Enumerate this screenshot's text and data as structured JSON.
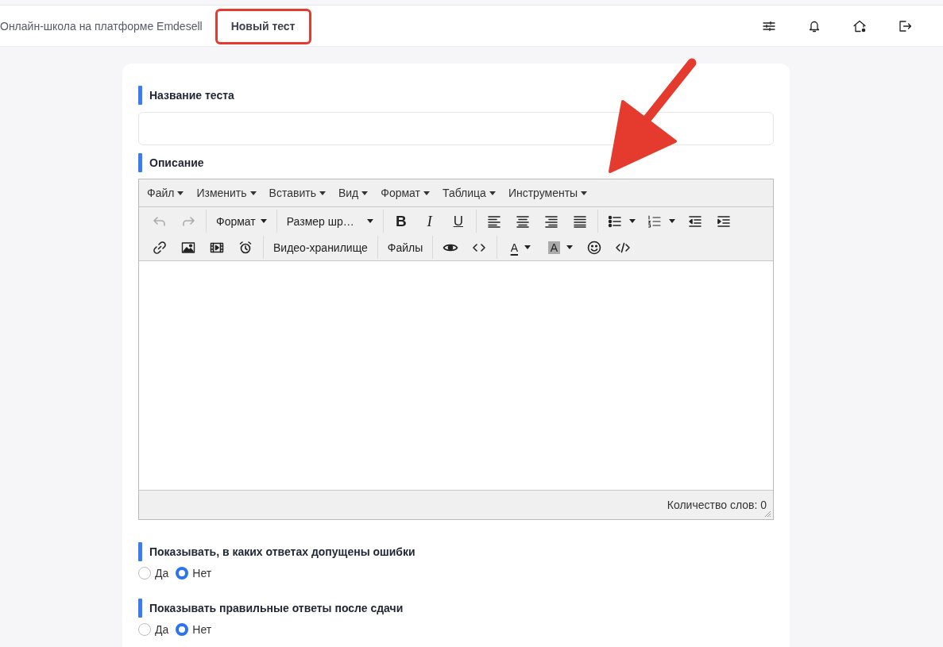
{
  "header": {
    "school": "Онлайн-школа на платформе Emdesell",
    "page_title": "Новый тест"
  },
  "sections": [
    {
      "kind": "text-input",
      "label": "Название теста"
    },
    {
      "kind": "editor",
      "label": "Описание",
      "editor": {
        "menu": [
          {
            "label": "Файл"
          },
          {
            "label": "Изменить"
          },
          {
            "label": "Вставить"
          },
          {
            "label": "Вид"
          },
          {
            "label": "Формат"
          },
          {
            "label": "Таблица"
          },
          {
            "label": "Инструменты"
          }
        ],
        "toolbar": [
          [
            [
              {
                "kind": "undo",
                "disabled": true
              },
              {
                "kind": "redo",
                "disabled": true
              }
            ],
            [
              {
                "kind": "dropdown",
                "label": "Формат",
                "disabled": false
              }
            ],
            [
              {
                "kind": "dropdown",
                "label": "Размер шр…",
                "disabled": false
              }
            ],
            [
              {
                "kind": "bold",
                "label": "B",
                "disabled": false
              },
              {
                "kind": "italic",
                "label": "I",
                "disabled": false
              },
              {
                "kind": "underline",
                "label": "U",
                "disabled": false
              }
            ],
            [
              {
                "kind": "alignleft",
                "disabled": false
              },
              {
                "kind": "aligncenter",
                "disabled": false
              },
              {
                "kind": "alignright",
                "disabled": false
              },
              {
                "kind": "justify",
                "disabled": false
              }
            ],
            [
              {
                "kind": "bullist",
                "disabled": false
              },
              {
                "kind": "numlist",
                "disabled": false
              },
              {
                "kind": "outdent",
                "disabled": false
              },
              {
                "kind": "indent",
                "disabled": false
              }
            ]
          ],
          [
            [
              {
                "kind": "link",
                "disabled": false
              },
              {
                "kind": "image",
                "disabled": false
              },
              {
                "kind": "media",
                "disabled": false
              },
              {
                "kind": "alarm",
                "disabled": false
              }
            ],
            [
              {
                "kind": "text",
                "label": "Видео-хранилище",
                "disabled": false
              }
            ],
            [
              {
                "kind": "text",
                "label": "Файлы",
                "disabled": false
              }
            ],
            [
              {
                "kind": "preview",
                "disabled": false
              },
              {
                "kind": "code",
                "disabled": false
              }
            ],
            [
              {
                "kind": "forecolor",
                "label": "A",
                "disabled": false
              },
              {
                "kind": "backcolor",
                "label": "A",
                "disabled": false
              },
              {
                "kind": "emoticon",
                "disabled": false
              },
              {
                "kind": "source",
                "disabled": false
              }
            ]
          ]
        ],
        "status": "Количество слов: 0"
      }
    },
    {
      "kind": "radio",
      "label": "Показывать, в каких ответах допущены ошибки",
      "options": [
        {
          "label": "Да",
          "selected": false
        },
        {
          "label": "Нет",
          "selected": true
        }
      ]
    },
    {
      "kind": "radio",
      "label": "Показывать правильные ответы после сдачи",
      "options": [
        {
          "label": "Да",
          "selected": false
        },
        {
          "label": "Нет",
          "selected": true
        }
      ]
    }
  ]
}
